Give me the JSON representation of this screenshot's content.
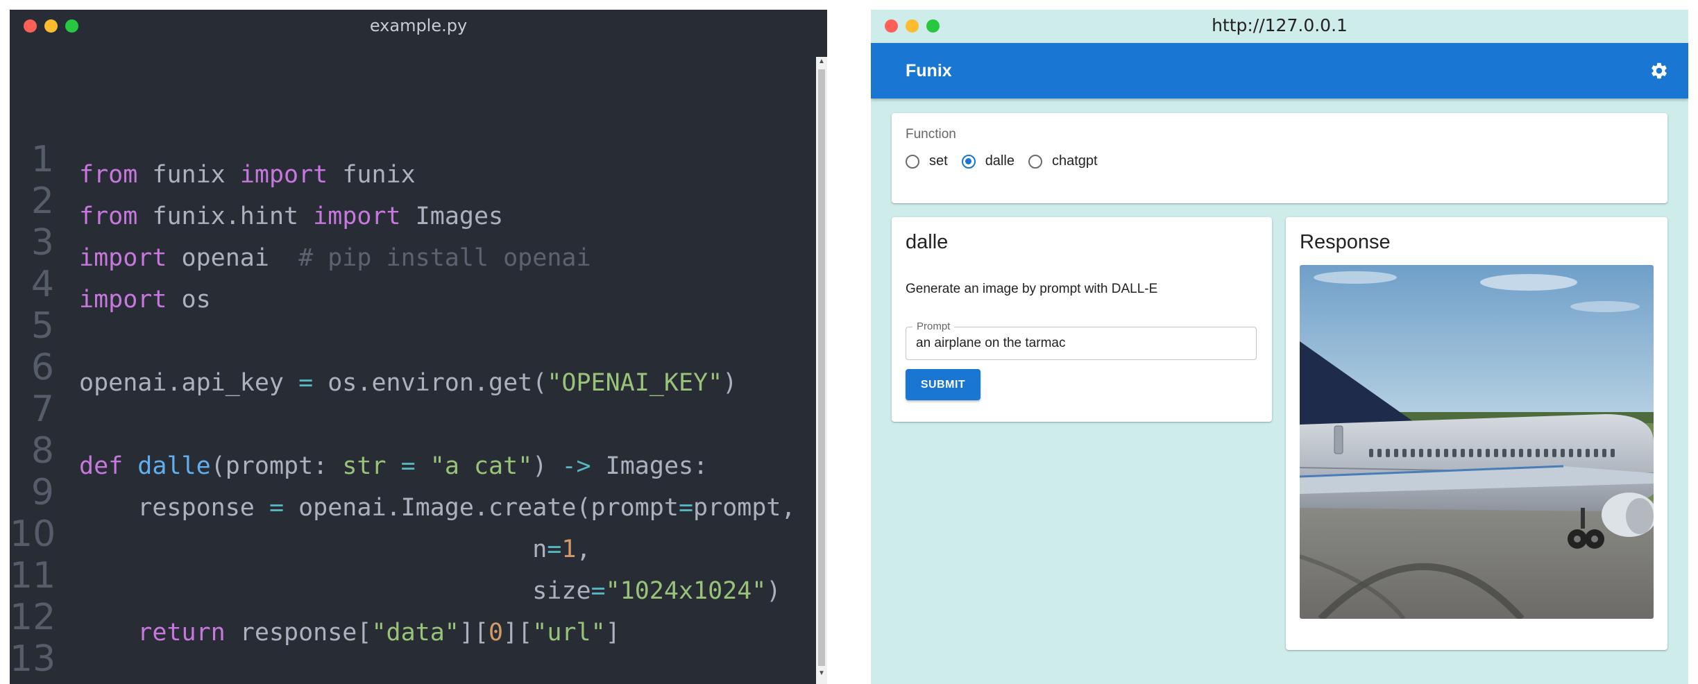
{
  "editor": {
    "title": "example.py",
    "line_numbers": [
      "1",
      "2",
      "3",
      "4",
      "5",
      "6",
      "7",
      "8",
      "9",
      "10",
      "11",
      "12",
      "13"
    ],
    "code": {
      "l1_from": "from",
      "l1_mod": " funix ",
      "l1_import": "import",
      "l1_name": " funix",
      "l2_from": "from",
      "l2_mod": " funix.hint ",
      "l2_import": "import",
      "l2_name": " Images",
      "l3_import": "import",
      "l3_name": " openai  ",
      "l3_comment": "# pip install openai",
      "l4_import": "import",
      "l4_name": " os",
      "l6_a": "openai.api_key ",
      "l6_eq": "=",
      "l6_b": " os.environ.get(",
      "l6_str": "\"OPENAI_KEY\"",
      "l6_c": ")",
      "l8_def": "def",
      "l8_sp": " ",
      "l8_fn": "dalle",
      "l8_a": "(prompt: ",
      "l8_type": "str",
      "l8_sp2": " ",
      "l8_eq": "=",
      "l8_sp3": " ",
      "l8_str": "\"a cat\"",
      "l8_b": ") ",
      "l8_arrow": "->",
      "l8_c": " Images:",
      "l9_a": "    response ",
      "l9_eq": "=",
      "l9_b": " openai.Image.create(prompt",
      "l9_eq2": "=",
      "l9_c": "prompt,",
      "l10_a": "                               n",
      "l10_eq": "=",
      "l10_num": "1",
      "l10_c": ",",
      "l11_a": "                               size",
      "l11_eq": "=",
      "l11_str": "\"1024x1024\"",
      "l11_c": ")",
      "l13_sp": "    ",
      "l13_ret": "return",
      "l13_a": " response[",
      "l13_s1": "\"data\"",
      "l13_b": "][",
      "l13_num": "0",
      "l13_c": "][",
      "l13_s2": "\"url\"",
      "l13_d": "]"
    }
  },
  "browser": {
    "url": "http://127.0.0.1",
    "brand": "Funix",
    "settings_icon": "gear-icon",
    "function_label": "Function",
    "functions": [
      {
        "label": "set",
        "selected": false
      },
      {
        "label": "dalle",
        "selected": true
      },
      {
        "label": "chatgpt",
        "selected": false
      }
    ],
    "form": {
      "title": "dalle",
      "description": "Generate an image by prompt with DALL-E",
      "prompt_label": "Prompt",
      "prompt_value": "an airplane on the tarmac",
      "submit_label": "SUBMIT"
    },
    "response": {
      "title": "Response",
      "image_subject": "airplane on tarmac"
    }
  },
  "colors": {
    "editor_bg": "#282c34",
    "keyword": "#c678dd",
    "function": "#61afef",
    "string": "#98c379",
    "operator": "#56b6c2",
    "number": "#d19a66",
    "comment": "#5c6370",
    "browser_bg": "#ceecea",
    "appbar": "#1976d2"
  }
}
